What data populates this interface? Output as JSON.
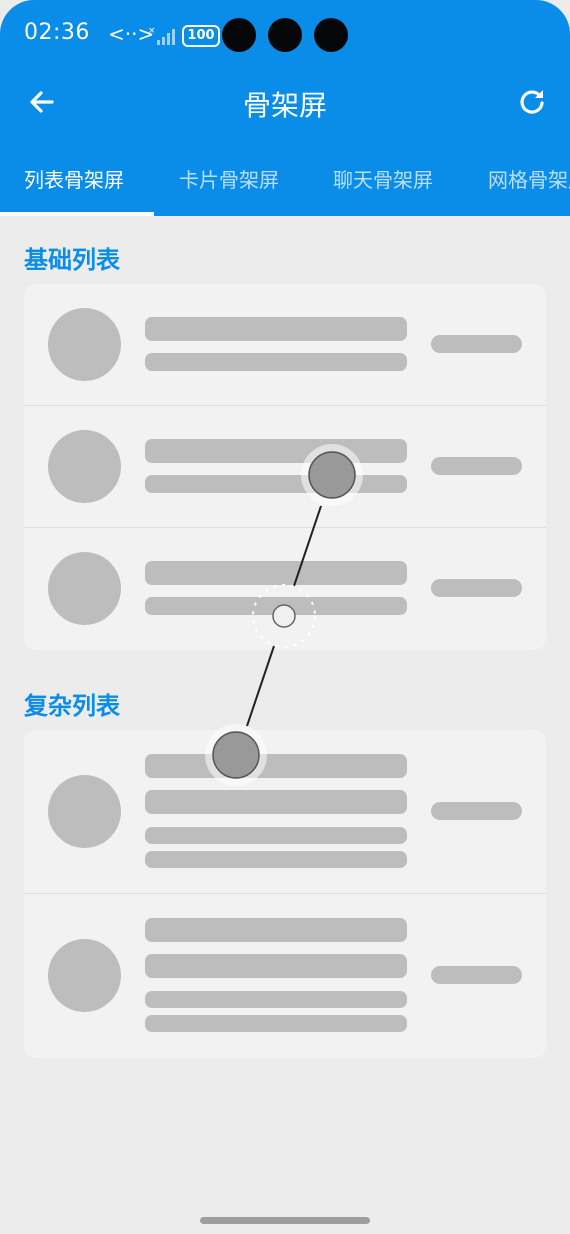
{
  "status_bar": {
    "time": "02:36",
    "network_symbol": "<··>",
    "battery": "100"
  },
  "app_bar": {
    "title": "骨架屏",
    "back_icon": "arrow-left-icon",
    "refresh_icon": "refresh-icon"
  },
  "tabs": [
    {
      "label": "列表骨架屏",
      "active": true
    },
    {
      "label": "卡片骨架屏",
      "active": false
    },
    {
      "label": "聊天骨架屏",
      "active": false
    },
    {
      "label": "网格骨架屏",
      "active": false
    }
  ],
  "sections": {
    "basic": {
      "title": "基础列表"
    },
    "complex": {
      "title": "复杂列表"
    }
  },
  "colors": {
    "primary": "#0a8ce9",
    "skeleton": "#bdbdbd",
    "card": "#f2f2f2",
    "background": "#ececec"
  }
}
